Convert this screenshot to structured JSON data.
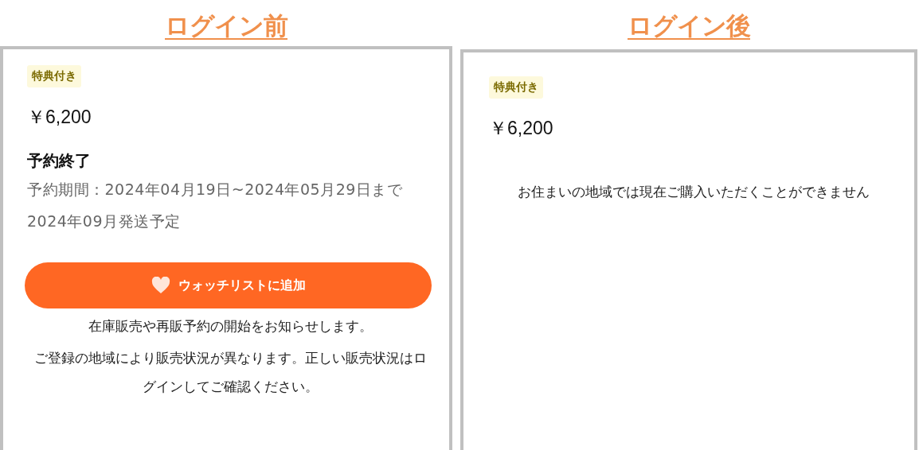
{
  "panels": [
    {
      "heading": "ログイン前",
      "badge": "特典付き",
      "price": "￥6,200",
      "blocks": [
        {
          "kind": "status",
          "text": "予約終了"
        },
        {
          "kind": "period",
          "text": "予約期間：2024年04月19日~2024年05月29日まで 2024年09月発送予定"
        },
        {
          "kind": "button",
          "text": "ウォッチリストに追加"
        },
        {
          "kind": "note",
          "text": "在庫販売や再販予約の開始をお知らせします。"
        },
        {
          "kind": "note",
          "text": "ご登録の地域により販売状況が異なります。正しい販売状況はログインしてご確認ください。"
        }
      ]
    },
    {
      "heading": "ログイン後",
      "badge": "特典付き",
      "price": "￥6,200",
      "blocks": [
        {
          "kind": "message",
          "text": "お住まいの地域では現在ご購入いただくことができません"
        }
      ]
    }
  ]
}
